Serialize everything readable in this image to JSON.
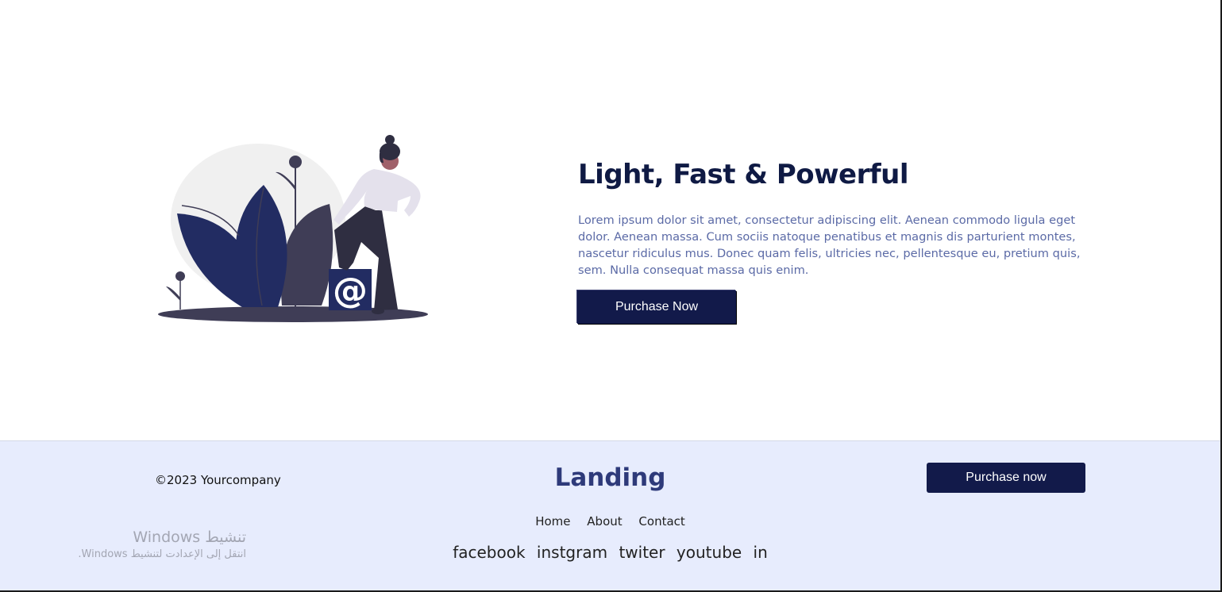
{
  "hero": {
    "title": "Light, Fast & Powerful",
    "body": "Lorem ipsum dolor sit amet, consectetur adipiscing elit. Aenean commodo ligula eget dolor. Aenean massa. Cum sociis natoque penatibus et magnis dis parturient montes, nascetur ridiculus mus. Donec quam felis, ultricies nec, pellentesque eu, pretium quis, sem. Nulla consequat massa quis enim.",
    "button_label": "Purchase Now",
    "illustration_icon": "at-sign-icon"
  },
  "footer": {
    "copyright": "©2023 Yourcompany",
    "brand": "Landing",
    "button_label": "Purchase now",
    "nav": [
      "Home",
      "About",
      "Contact"
    ],
    "social": [
      "facebook",
      "instgram",
      "twiter",
      "youtube",
      "in"
    ]
  },
  "windows_activation": {
    "title": "تنشيط Windows",
    "subtitle": "انتقل إلى الإعدادت لتنشيط Windows."
  },
  "colors": {
    "accent": "#121a4a",
    "title": "#0f1a44",
    "body_text": "#5b6aa6",
    "footer_bg": "#e7ecfd",
    "brand": "#2e3a7a"
  }
}
